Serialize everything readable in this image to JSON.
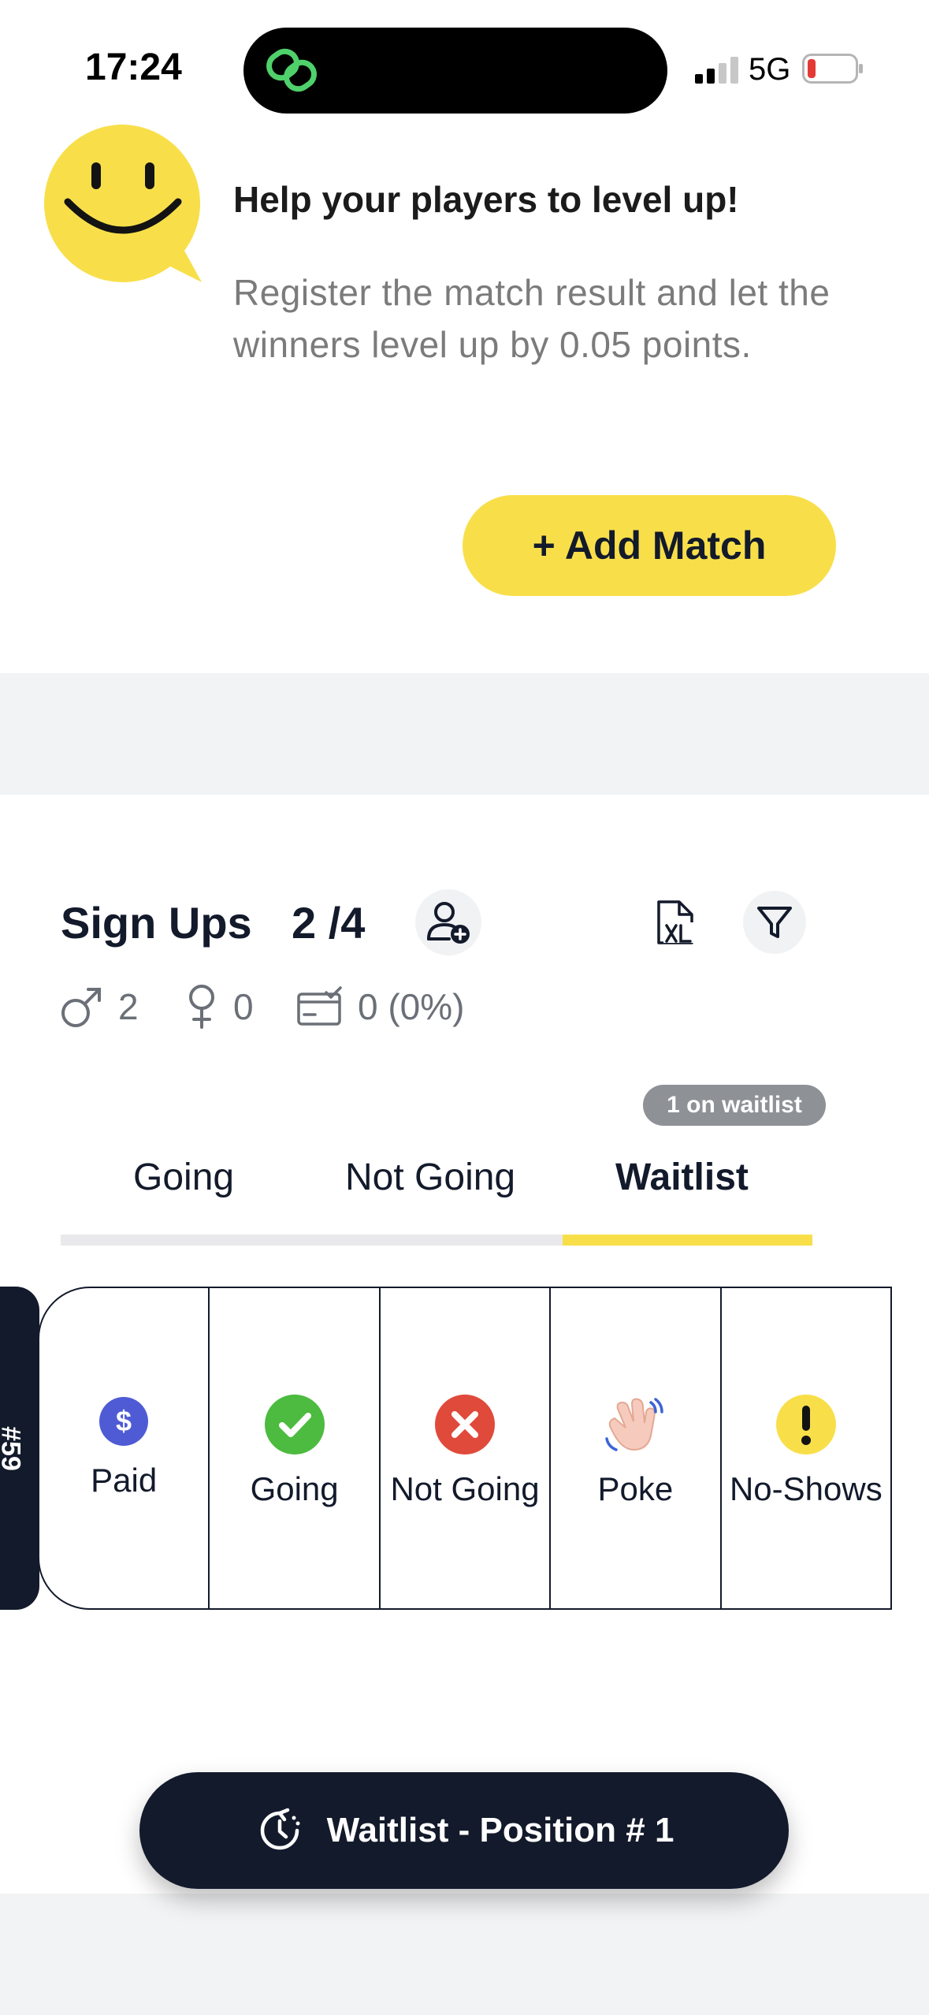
{
  "status_bar": {
    "time": "17:24",
    "network": "5G",
    "battery_color": "#e53935"
  },
  "promo": {
    "title": "Help your players to level up!",
    "text": "Register the match result and let the winners level up by 0.05 points.",
    "add_match_label": "+ Add Match",
    "accent_color": "#f8df4a"
  },
  "signups": {
    "title": "Sign Ups",
    "count": "2 /4",
    "male_count": "2",
    "female_count": "0",
    "paid_stat": "0 (0%)"
  },
  "waitlist_badge": "1 on waitlist",
  "tabs": [
    {
      "label": "Going",
      "active": false
    },
    {
      "label": "Not Going",
      "active": false
    },
    {
      "label": "Waitlist",
      "active": true
    }
  ],
  "player_rank": "#59",
  "actions": [
    {
      "label": "Paid",
      "icon": "dollar-icon",
      "color": "#4f5bd5"
    },
    {
      "label": "Going",
      "icon": "check-icon",
      "color": "#4cbb3f"
    },
    {
      "label": "Not Going",
      "icon": "close-icon",
      "color": "#e04a3a"
    },
    {
      "label": "Poke",
      "icon": "wave-hand-icon",
      "color": "#f2c1b0"
    },
    {
      "label": "No-Shows",
      "icon": "exclamation-icon",
      "color": "#f8df4a"
    }
  ],
  "bottom_button": {
    "label": "Waitlist - Position # 1"
  }
}
